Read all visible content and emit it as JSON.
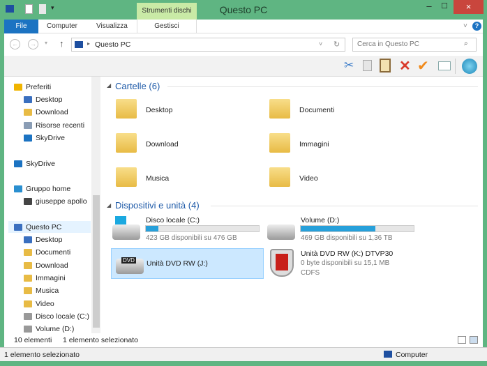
{
  "window": {
    "title": "Questo PC",
    "context_tab": "Strumenti dischi",
    "close": "×",
    "minimize": "–",
    "maximize": "☐"
  },
  "ribbon": {
    "tabs": [
      "File",
      "Computer",
      "Visualizza",
      "Gestisci"
    ],
    "expand": "˅",
    "help": "?"
  },
  "address": {
    "path": "Questo PC",
    "search_placeholder": "Cerca in Questo PC"
  },
  "toolbar": {
    "icons": [
      "scissors-icon",
      "copy-icon",
      "paste-icon",
      "delete-icon",
      "check-icon",
      "card-icon",
      "globe-icon"
    ]
  },
  "sidebar": {
    "items": [
      {
        "label": "Preferiti",
        "color": "#f0b400",
        "indent": 0
      },
      {
        "label": "Desktop",
        "color": "#3a6fbf",
        "indent": 1
      },
      {
        "label": "Download",
        "color": "#e8bb45",
        "indent": 1
      },
      {
        "label": "Risorse recenti",
        "color": "#8a9db5",
        "indent": 1
      },
      {
        "label": "SkyDrive",
        "color": "#1c73c2",
        "indent": 1
      },
      {
        "label": "SkyDrive",
        "color": "#1c73c2",
        "indent": 0
      },
      {
        "label": "Gruppo home",
        "color": "#2a8fd0",
        "indent": 0
      },
      {
        "label": "giuseppe apollo",
        "color": "#444",
        "indent": 1
      },
      {
        "label": "Questo PC",
        "color": "#3a6fbf",
        "indent": 0
      },
      {
        "label": "Desktop",
        "color": "#3a6fbf",
        "indent": 1
      },
      {
        "label": "Documenti",
        "color": "#e8bb45",
        "indent": 1
      },
      {
        "label": "Download",
        "color": "#e8bb45",
        "indent": 1
      },
      {
        "label": "Immagini",
        "color": "#e8bb45",
        "indent": 1
      },
      {
        "label": "Musica",
        "color": "#e8bb45",
        "indent": 1
      },
      {
        "label": "Video",
        "color": "#e8bb45",
        "indent": 1
      },
      {
        "label": "Disco locale (C:)",
        "color": "#999",
        "indent": 1
      },
      {
        "label": "Volume (D:)",
        "color": "#999",
        "indent": 1
      }
    ]
  },
  "folders": {
    "header": "Cartelle (6)",
    "items": [
      "Desktop",
      "Documenti",
      "Download",
      "Immagini",
      "Musica",
      "Video"
    ]
  },
  "devices": {
    "header": "Dispositivi e unità (4)",
    "items": [
      {
        "name": "Disco locale (C:)",
        "detail": "423 GB disponibili su 476 GB",
        "used_pct": 11
      },
      {
        "name": "Volume (D:)",
        "detail": "469 GB disponibili su 1,36 TB",
        "used_pct": 66
      },
      {
        "name": "Unità DVD RW (J:)",
        "selected": true,
        "badge": "DVD"
      },
      {
        "name": "Unità DVD RW (K:) DTVP30",
        "detail": "0 byte disponibili su 15,1 MB",
        "fs": "CDFS"
      }
    ]
  },
  "status": {
    "count": "10 elementi",
    "selection": "1 elemento selezionato"
  },
  "outer_status": {
    "text": "1 elemento selezionato",
    "location": "Computer"
  },
  "colors": {
    "frame": "#5fb582",
    "accent": "#1c73c2",
    "bar": "#27a0da",
    "selection": "#cce8ff"
  }
}
